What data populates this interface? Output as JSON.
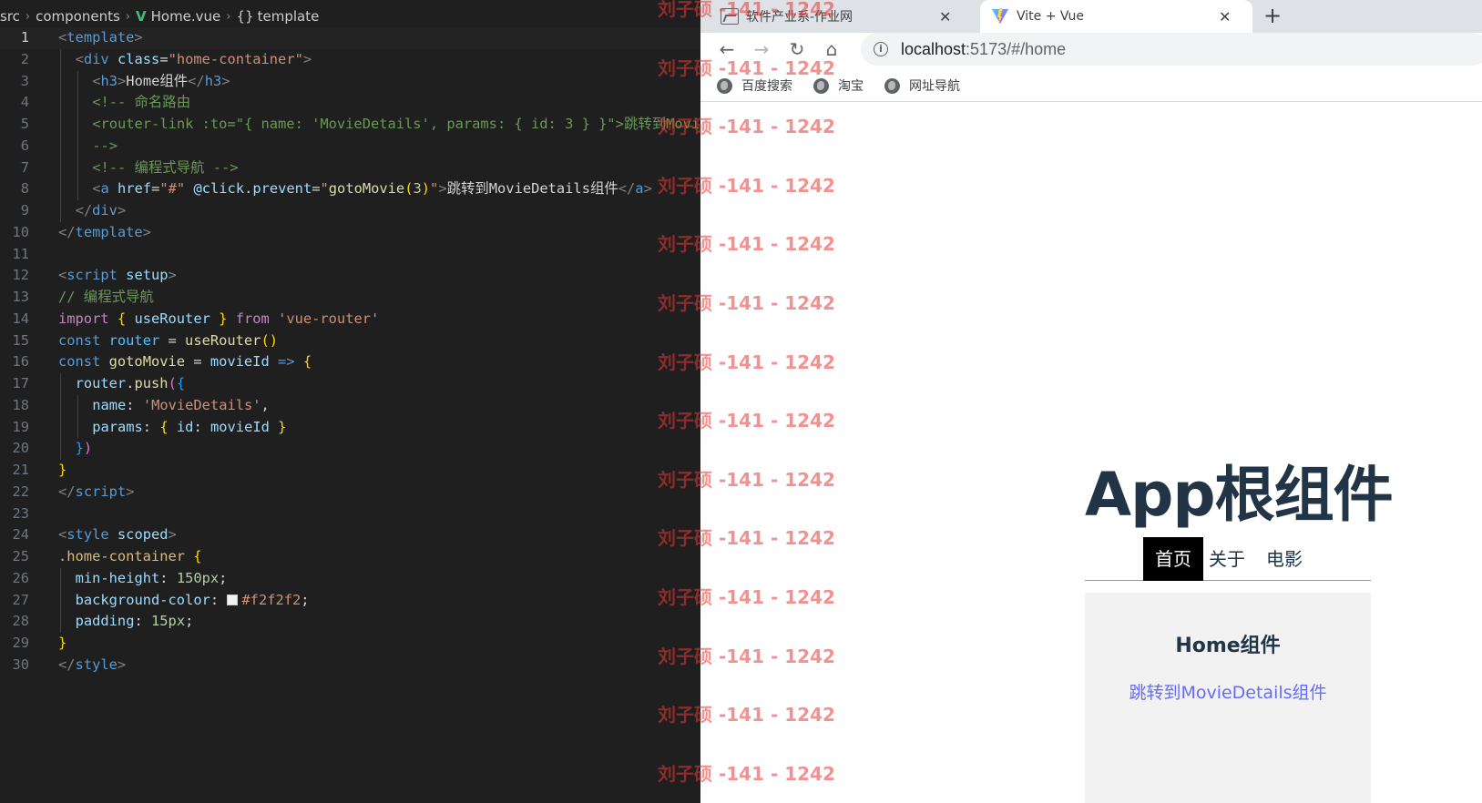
{
  "editor": {
    "breadcrumb": {
      "segments": [
        "src",
        "components",
        "Home.vue",
        "template"
      ],
      "file_icon": "vue-icon",
      "symbol_icon": "braces-icon"
    },
    "active_line": 1,
    "lines": [
      {
        "n": "1",
        "indent": 0,
        "tokens": [
          [
            "t-punc",
            "<"
          ],
          [
            "t-tag",
            "template"
          ],
          [
            "t-punc",
            ">"
          ]
        ]
      },
      {
        "n": "2",
        "indent": 1,
        "tokens": [
          [
            "t-punc",
            "<"
          ],
          [
            "t-tag",
            "div"
          ],
          [
            "t-text",
            " "
          ],
          [
            "t-attr",
            "class"
          ],
          [
            "t-text",
            "="
          ],
          [
            "t-str",
            "\"home-container\""
          ],
          [
            "t-punc",
            ">"
          ]
        ]
      },
      {
        "n": "3",
        "indent": 2,
        "tokens": [
          [
            "t-punc",
            "<"
          ],
          [
            "t-tag",
            "h3"
          ],
          [
            "t-punc",
            ">"
          ],
          [
            "t-text",
            "Home组件"
          ],
          [
            "t-punc",
            "</"
          ],
          [
            "t-tag",
            "h3"
          ],
          [
            "t-punc",
            ">"
          ]
        ]
      },
      {
        "n": "4",
        "indent": 2,
        "tokens": [
          [
            "t-comment",
            "<!-- 命名路由"
          ]
        ]
      },
      {
        "n": "5",
        "indent": 2,
        "tokens": [
          [
            "t-comment",
            "<router-link :to=\"{ name: 'MovieDetails', params: { id: 3 } }\">跳转到MovieDetails组件</router-link>"
          ]
        ]
      },
      {
        "n": "6",
        "indent": 2,
        "tokens": [
          [
            "t-comment",
            "-->"
          ]
        ]
      },
      {
        "n": "7",
        "indent": 2,
        "tokens": [
          [
            "t-comment",
            "<!-- 编程式导航 -->"
          ]
        ]
      },
      {
        "n": "8",
        "indent": 2,
        "tokens": [
          [
            "t-punc",
            "<"
          ],
          [
            "t-tag",
            "a"
          ],
          [
            "t-text",
            " "
          ],
          [
            "t-attr",
            "href"
          ],
          [
            "t-text",
            "="
          ],
          [
            "t-str",
            "\"#\""
          ],
          [
            "t-text",
            " "
          ],
          [
            "t-attr",
            "@click.prevent"
          ],
          [
            "t-text",
            "="
          ],
          [
            "t-str",
            "\""
          ],
          [
            "t-fn",
            "gotoMovie"
          ],
          [
            "t-b1",
            "("
          ],
          [
            "t-num",
            "3"
          ],
          [
            "t-b1",
            ")"
          ],
          [
            "t-str",
            "\""
          ],
          [
            "t-punc",
            ">"
          ],
          [
            "t-text",
            "跳转到MovieDetails组件"
          ],
          [
            "t-punc",
            "</"
          ],
          [
            "t-tag",
            "a"
          ],
          [
            "t-punc",
            ">"
          ]
        ]
      },
      {
        "n": "9",
        "indent": 1,
        "tokens": [
          [
            "t-punc",
            "</"
          ],
          [
            "t-tag",
            "div"
          ],
          [
            "t-punc",
            ">"
          ]
        ]
      },
      {
        "n": "10",
        "indent": 0,
        "tokens": [
          [
            "t-punc",
            "</"
          ],
          [
            "t-tag",
            "template"
          ],
          [
            "t-punc",
            ">"
          ]
        ]
      },
      {
        "n": "11",
        "indent": 0,
        "tokens": []
      },
      {
        "n": "12",
        "indent": 0,
        "tokens": [
          [
            "t-punc",
            "<"
          ],
          [
            "t-tag",
            "script"
          ],
          [
            "t-text",
            " "
          ],
          [
            "t-attr",
            "setup"
          ],
          [
            "t-punc",
            ">"
          ]
        ]
      },
      {
        "n": "13",
        "indent": 0,
        "tokens": [
          [
            "t-comment",
            "// 编程式导航"
          ]
        ]
      },
      {
        "n": "14",
        "indent": 0,
        "tokens": [
          [
            "t-key",
            "import"
          ],
          [
            "t-text",
            " "
          ],
          [
            "t-b1",
            "{"
          ],
          [
            "t-text",
            " "
          ],
          [
            "t-attr",
            "useRouter"
          ],
          [
            "t-text",
            " "
          ],
          [
            "t-b1",
            "}"
          ],
          [
            "t-text",
            " "
          ],
          [
            "t-key",
            "from"
          ],
          [
            "t-text",
            " "
          ],
          [
            "t-str",
            "'vue-router'"
          ]
        ]
      },
      {
        "n": "15",
        "indent": 0,
        "tokens": [
          [
            "t-storage",
            "const"
          ],
          [
            "t-text",
            " "
          ],
          [
            "t-var",
            "router"
          ],
          [
            "t-text",
            " = "
          ],
          [
            "t-fn",
            "useRouter"
          ],
          [
            "t-b1",
            "()"
          ]
        ]
      },
      {
        "n": "16",
        "indent": 0,
        "tokens": [
          [
            "t-storage",
            "const"
          ],
          [
            "t-text",
            " "
          ],
          [
            "t-fn",
            "gotoMovie"
          ],
          [
            "t-text",
            " = "
          ],
          [
            "t-attr",
            "movieId"
          ],
          [
            "t-text",
            " "
          ],
          [
            "t-storage",
            "=>"
          ],
          [
            "t-text",
            " "
          ],
          [
            "t-b1",
            "{"
          ]
        ]
      },
      {
        "n": "17",
        "indent": 1,
        "tokens": [
          [
            "t-attr",
            "router"
          ],
          [
            "t-text",
            "."
          ],
          [
            "t-fn",
            "push"
          ],
          [
            "t-b2",
            "("
          ],
          [
            "t-b3",
            "{"
          ]
        ]
      },
      {
        "n": "18",
        "indent": 2,
        "tokens": [
          [
            "t-attr",
            "name"
          ],
          [
            "t-text",
            ": "
          ],
          [
            "t-str",
            "'MovieDetails'"
          ],
          [
            "t-text",
            ","
          ]
        ]
      },
      {
        "n": "19",
        "indent": 2,
        "tokens": [
          [
            "t-attr",
            "params"
          ],
          [
            "t-text",
            ": "
          ],
          [
            "t-b1",
            "{"
          ],
          [
            "t-text",
            " "
          ],
          [
            "t-attr",
            "id"
          ],
          [
            "t-text",
            ": "
          ],
          [
            "t-attr",
            "movieId"
          ],
          [
            "t-text",
            " "
          ],
          [
            "t-b1",
            "}"
          ]
        ]
      },
      {
        "n": "20",
        "indent": 1,
        "tokens": [
          [
            "t-b3",
            "}"
          ],
          [
            "t-b2",
            ")"
          ]
        ]
      },
      {
        "n": "21",
        "indent": 0,
        "tokens": [
          [
            "t-b1",
            "}"
          ]
        ]
      },
      {
        "n": "22",
        "indent": 0,
        "tokens": [
          [
            "t-punc",
            "</"
          ],
          [
            "t-tag",
            "script"
          ],
          [
            "t-punc",
            ">"
          ]
        ]
      },
      {
        "n": "23",
        "indent": 0,
        "tokens": []
      },
      {
        "n": "24",
        "indent": 0,
        "tokens": [
          [
            "t-punc",
            "<"
          ],
          [
            "t-tag",
            "style"
          ],
          [
            "t-text",
            " "
          ],
          [
            "t-attr",
            "scoped"
          ],
          [
            "t-punc",
            ">"
          ]
        ]
      },
      {
        "n": "25",
        "indent": 0,
        "tokens": [
          [
            "t-sel",
            ".home-container"
          ],
          [
            "t-text",
            " "
          ],
          [
            "t-b1",
            "{"
          ]
        ]
      },
      {
        "n": "26",
        "indent": 1,
        "tokens": [
          [
            "t-prop",
            "min-height"
          ],
          [
            "t-text",
            ": "
          ],
          [
            "t-num",
            "150px"
          ],
          [
            "t-text",
            ";"
          ]
        ]
      },
      {
        "n": "27",
        "indent": 1,
        "tokens": [
          [
            "t-prop",
            "background-color"
          ],
          [
            "t-text",
            ": "
          ],
          [
            "swatch",
            ""
          ],
          [
            "t-str",
            "#f2f2f2"
          ],
          [
            "t-text",
            ";"
          ]
        ]
      },
      {
        "n": "28",
        "indent": 1,
        "tokens": [
          [
            "t-prop",
            "padding"
          ],
          [
            "t-text",
            ": "
          ],
          [
            "t-num",
            "15px"
          ],
          [
            "t-text",
            ";"
          ]
        ]
      },
      {
        "n": "29",
        "indent": 0,
        "tokens": [
          [
            "t-b1",
            "}"
          ]
        ]
      },
      {
        "n": "30",
        "indent": 0,
        "tokens": [
          [
            "t-punc",
            "</"
          ],
          [
            "t-tag",
            "style"
          ],
          [
            "t-punc",
            ">"
          ]
        ]
      }
    ]
  },
  "browser": {
    "tabs": [
      {
        "title": "软件产业系-作业网",
        "icon": "image-icon",
        "active": false
      },
      {
        "title": "Vite + Vue",
        "icon": "vite-icon",
        "active": true
      }
    ],
    "new_tab_label": "+",
    "close_label": "✕",
    "url_host": "localhost",
    "url_path": ":5173/#/home",
    "bookmarks": [
      "百度搜索",
      "淘宝",
      "网址导航"
    ],
    "page": {
      "app_title": "App根组件",
      "nav": [
        {
          "label": "首页",
          "active": true
        },
        {
          "label": "关于",
          "active": false
        },
        {
          "label": "电影",
          "active": false
        }
      ],
      "home_title": "Home组件",
      "home_link": "跳转到MovieDetails组件"
    }
  },
  "watermark": {
    "text": "刘子硕 -141 - 1242",
    "count": 14
  },
  "colors": {
    "editor_bg": "#1f1f1f",
    "heading": "#213547",
    "link": "#646cff",
    "home_bg": "#f2f2f2",
    "watermark": "#e53935"
  }
}
